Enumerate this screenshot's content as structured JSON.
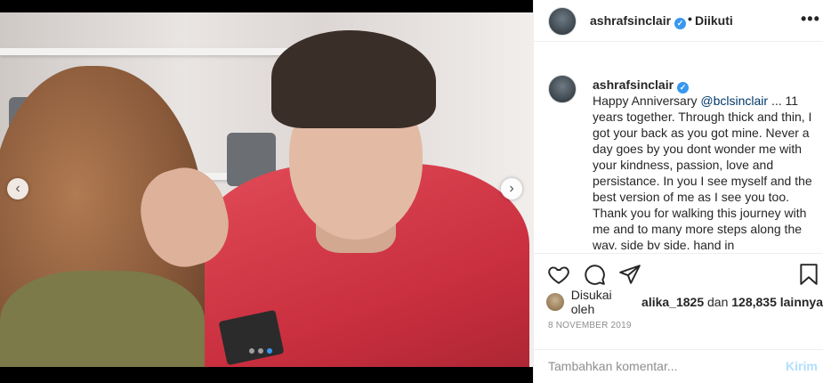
{
  "post": {
    "username": "ashrafsinclair",
    "follow_separator": "•",
    "follow_status": "Diikuti",
    "more_glyph": "•••",
    "verified_glyph": "✓",
    "caption_before_mention": "Happy Anniversary ",
    "caption_mention": "@bclsinclair",
    "caption_after_mention": " ... 11 years together. Through thick and thin, I got your back as you got mine. Never a day goes by you dont wonder me with your kindness, passion, love and persistance. In you I see myself and the best version of me as I see you too. Thank you for walking this journey with me and to many more steps along the way, side by side, hand in",
    "likes_prefix": "Disukai oleh",
    "likes_user": "alika_1825",
    "likes_joiner": "dan",
    "likes_count": "128,835",
    "likes_suffix": "lainnya",
    "date": "8 NOVEMBER 2019"
  },
  "media": {
    "prev_glyph": "‹",
    "next_glyph": "›",
    "slide_count": 3,
    "active_slide": 3
  },
  "comment": {
    "placeholder": "Tambahkan komentar...",
    "post_label": "Kirim"
  },
  "colors": {
    "accent": "#3897f0",
    "post_disabled": "#b2dffc"
  },
  "icons": {
    "like": "heart-icon",
    "comment": "comment-icon",
    "share": "paper-plane-icon",
    "save": "bookmark-icon",
    "verified": "verified-badge-icon",
    "more": "more-options-icon"
  }
}
